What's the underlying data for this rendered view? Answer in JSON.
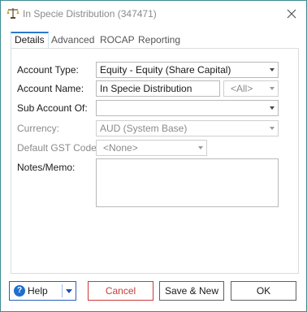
{
  "window": {
    "title": "In Specie Distribution (347471)"
  },
  "tabs": [
    {
      "label": "Details",
      "active": true
    },
    {
      "label": "Advanced",
      "active": false
    },
    {
      "label": "ROCAP",
      "active": false
    },
    {
      "label": "Reporting",
      "active": false
    }
  ],
  "form": {
    "account_type": {
      "label": "Account Type:",
      "value": "Equity - Equity (Share Capital)"
    },
    "account_name": {
      "label": "Account Name:",
      "value": "In Specie Distribution",
      "scope": "<All>"
    },
    "sub_account_of": {
      "label": "Sub Account Of:",
      "value": ""
    },
    "currency": {
      "label": "Currency:",
      "value": "AUD (System Base)"
    },
    "default_gst_code": {
      "label": "Default GST Code:",
      "value": "<None>"
    },
    "notes_memo": {
      "label": "Notes/Memo:",
      "value": ""
    }
  },
  "footer": {
    "help_label": "Help",
    "cancel_label": "Cancel",
    "save_new_label": "Save & New",
    "ok_label": "OK"
  },
  "colors": {
    "accent": "#2a79c9",
    "cancel": "#c83a3a",
    "border": "#3c8c93"
  },
  "icons": [
    "scales-icon",
    "close-icon",
    "help-icon",
    "chevron-down-icon"
  ]
}
